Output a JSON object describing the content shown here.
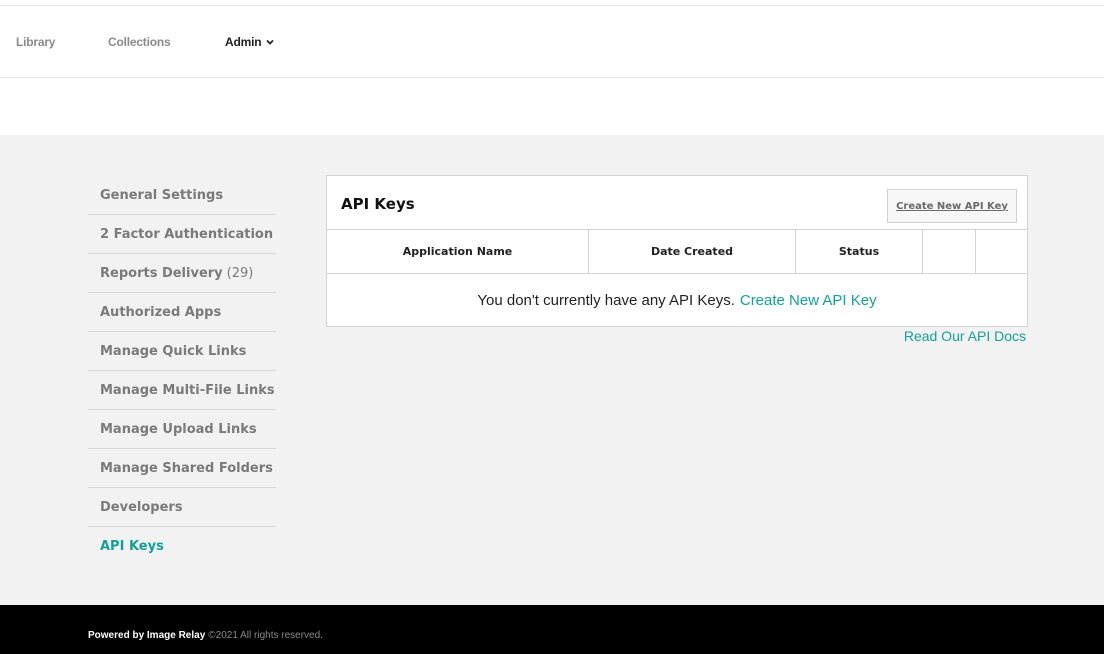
{
  "topnav": {
    "library": "Library",
    "collections": "Collections",
    "admin": "Admin",
    "admin_icon": "chevron-down-icon"
  },
  "sidebar": {
    "items": [
      {
        "label": "General Settings",
        "count": ""
      },
      {
        "label": "2 Factor Authentication",
        "count": ""
      },
      {
        "label": "Reports Delivery",
        "count": "(29)"
      },
      {
        "label": "Authorized Apps",
        "count": ""
      },
      {
        "label": "Manage Quick Links",
        "count": ""
      },
      {
        "label": "Manage Multi-File Links",
        "count": ""
      },
      {
        "label": "Manage Upload Links",
        "count": ""
      },
      {
        "label": "Manage Shared Folders",
        "count": ""
      },
      {
        "label": "Developers",
        "count": ""
      },
      {
        "label": "API Keys",
        "count": "",
        "active": true
      }
    ]
  },
  "panel": {
    "title": "API Keys",
    "create_button": "Create New API Key",
    "columns": [
      "Application Name",
      "Date Created",
      "Status",
      "",
      ""
    ],
    "empty_message": "You don't currently have any API Keys.",
    "empty_link": "Create New API Key"
  },
  "docs_link": "Read Our API Docs",
  "footer": {
    "powered": "Powered by Image Relay",
    "copyright": "©2021 All rights reserved."
  },
  "colors": {
    "accent": "#13a195",
    "gray_bg": "#f2f2f2",
    "footer_bg": "#000000"
  }
}
